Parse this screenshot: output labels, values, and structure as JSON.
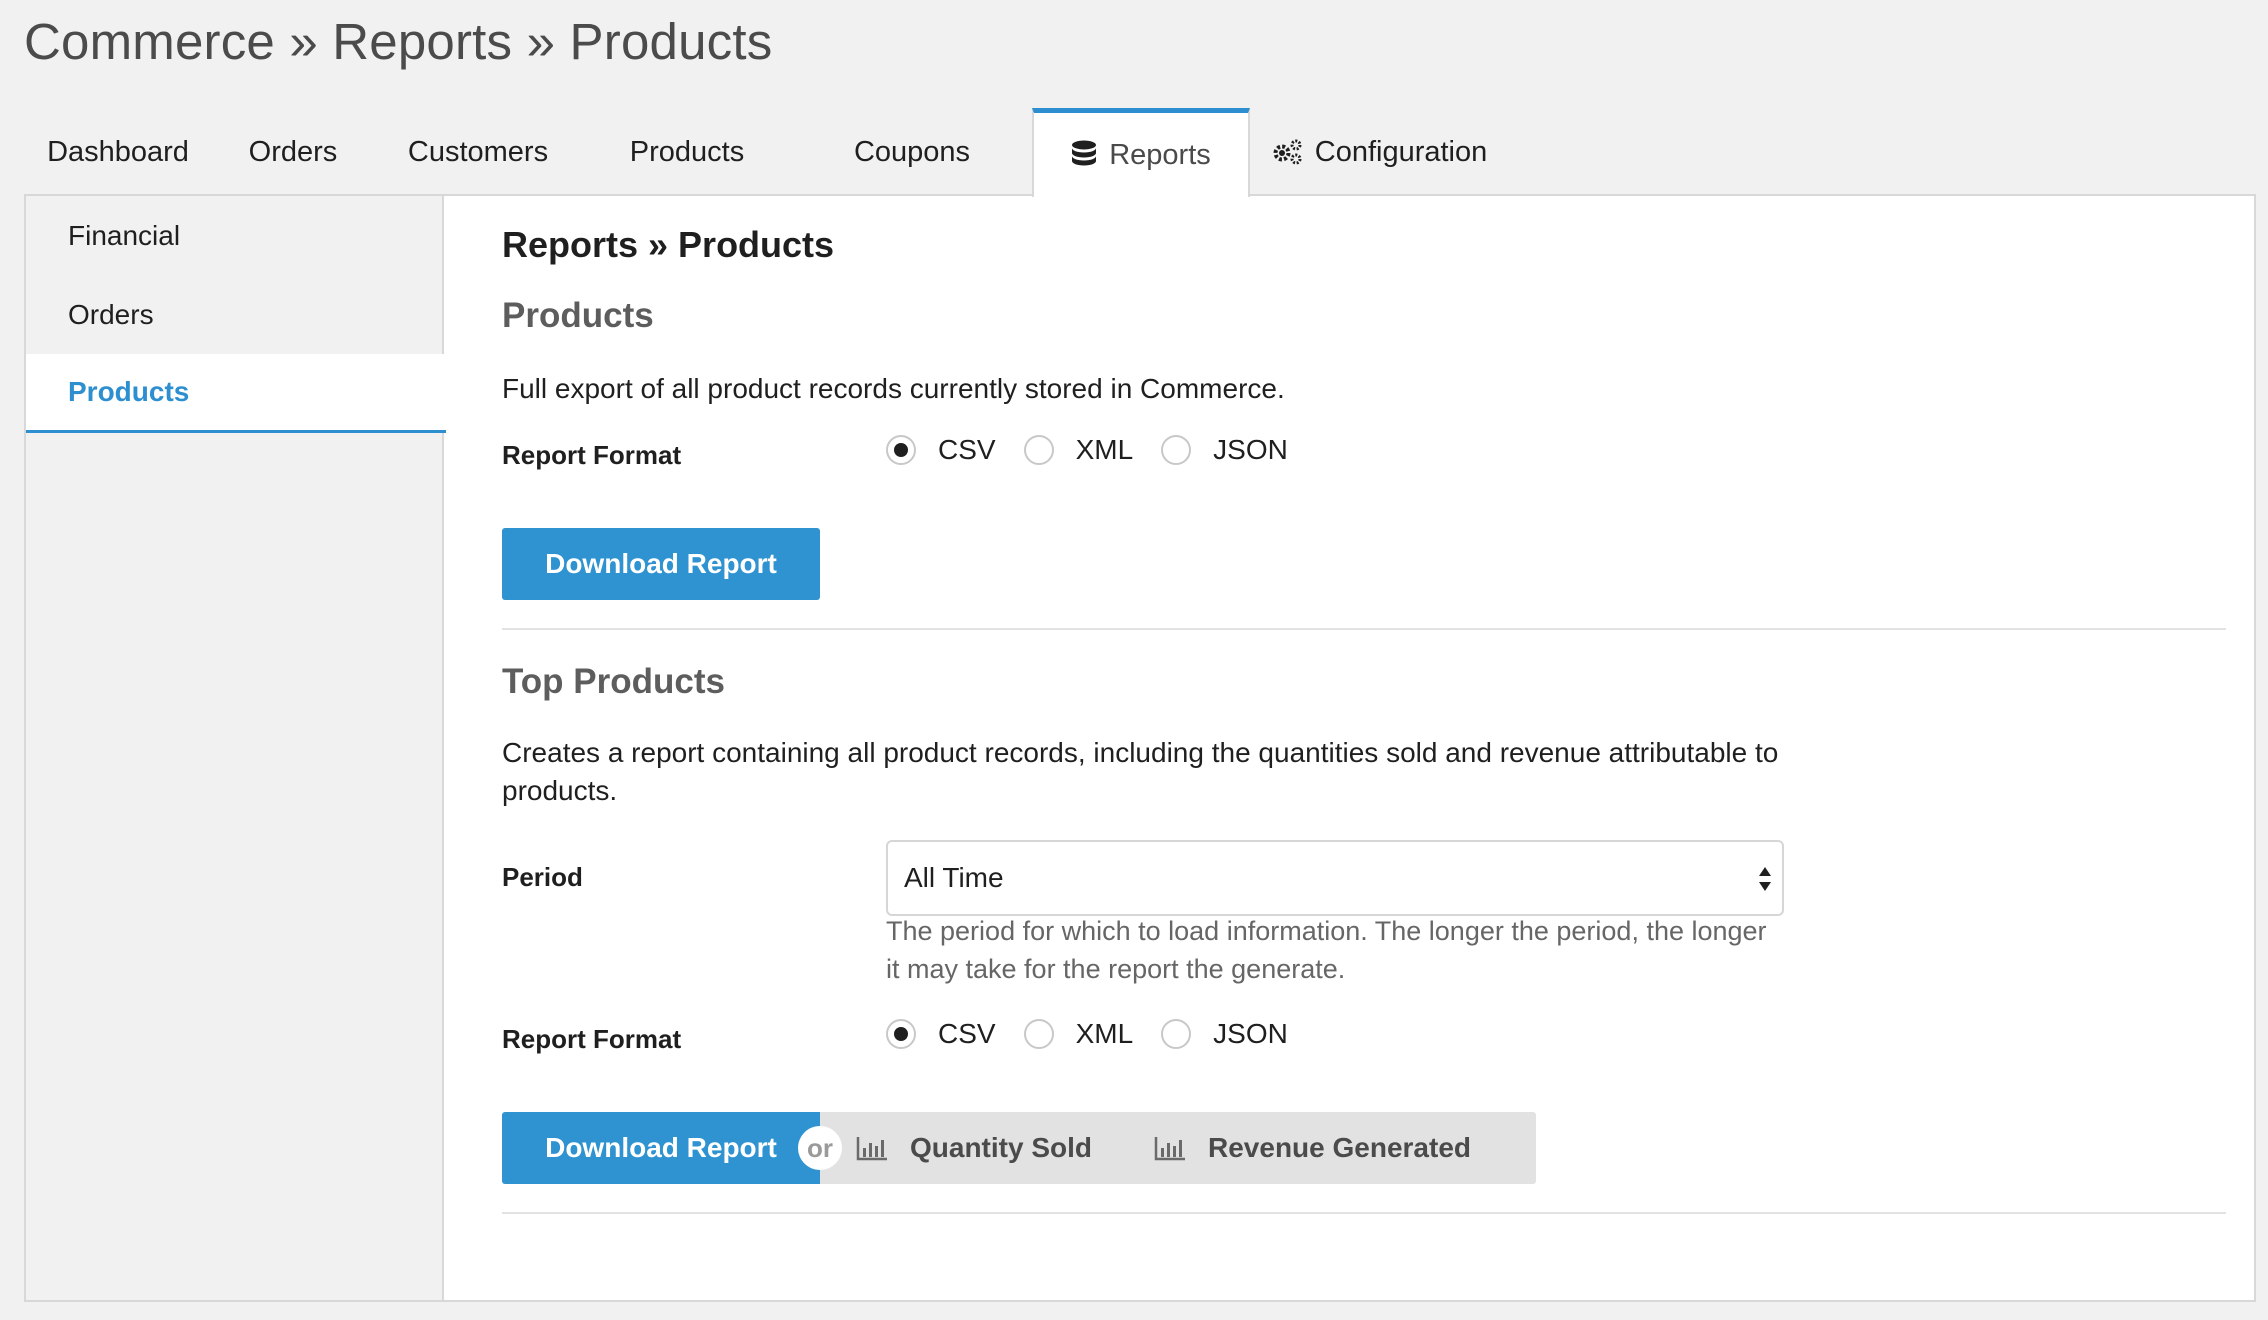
{
  "page_title": "Commerce » Reports » Products",
  "tabs": [
    {
      "label": "Dashboard",
      "icon": "",
      "active": false
    },
    {
      "label": "Orders",
      "icon": "",
      "active": false
    },
    {
      "label": "Customers",
      "icon": "",
      "active": false
    },
    {
      "label": "Products",
      "icon": "",
      "active": false
    },
    {
      "label": "Coupons",
      "icon": "",
      "active": false
    },
    {
      "label": "Reports",
      "icon": "database-icon",
      "active": true
    },
    {
      "label": "Configuration",
      "icon": "gears-icon",
      "active": false
    }
  ],
  "sidebar": {
    "items": [
      {
        "label": "Financial",
        "active": false
      },
      {
        "label": "Orders",
        "active": false
      },
      {
        "label": "Products",
        "active": true
      }
    ]
  },
  "main": {
    "breadcrumb": "Reports » Products",
    "products_section": {
      "title": "Products",
      "description": "Full export of all product records currently stored in Commerce.",
      "format_label": "Report Format",
      "formats": [
        "CSV",
        "XML",
        "JSON"
      ],
      "selected_format": "CSV",
      "download_label": "Download Report"
    },
    "top_products_section": {
      "title": "Top Products",
      "description": "Creates a report containing all product records, including the quantities sold and revenue attributable to products.",
      "period_label": "Period",
      "period_value": "All Time",
      "period_help": "The period for which to load information. The longer the period, the longer it may take for the report the generate.",
      "format_label": "Report Format",
      "formats": [
        "CSV",
        "XML",
        "JSON"
      ],
      "selected_format": "CSV",
      "download_label": "Download Report",
      "or_label": "or",
      "quantity_sold_label": "Quantity Sold",
      "revenue_generated_label": "Revenue Generated"
    }
  },
  "colors": {
    "accent": "#2f93d1",
    "background": "#f1f1f1",
    "panel": "#ffffff"
  }
}
